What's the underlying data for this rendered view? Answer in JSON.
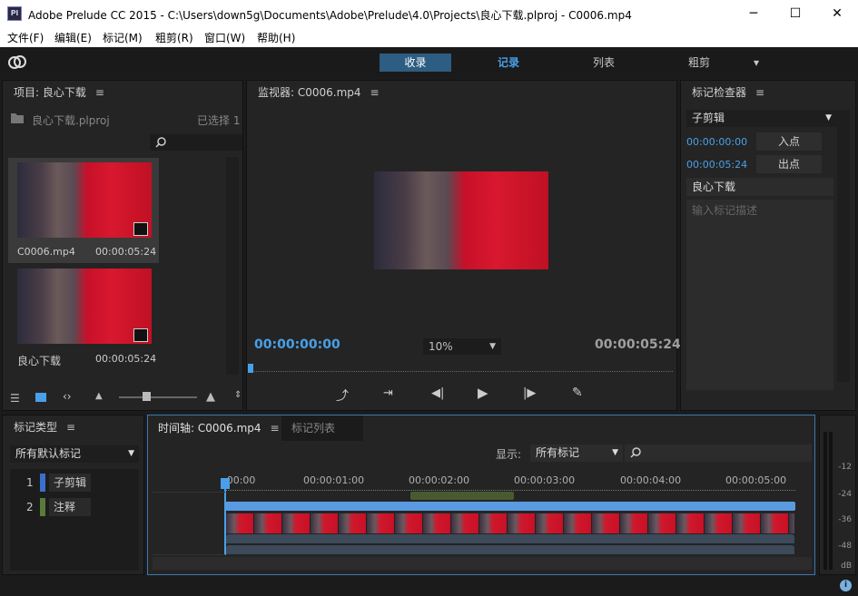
{
  "window": {
    "title": "Adobe Prelude CC 2015 - C:\\Users\\down5g\\Documents\\Adobe\\Prelude\\4.0\\Projects\\良心下载.plproj - C0006.mp4",
    "app_icon": "Pl",
    "minimize": "─",
    "maximize": "☐",
    "close": "✕"
  },
  "menu": [
    "文件(F)",
    "编辑(E)",
    "标记(M)",
    "粗剪(R)",
    "窗口(W)",
    "帮助(H)"
  ],
  "workspaces": {
    "ingest": "收录",
    "log": "记录",
    "list": "列表",
    "rough": "粗剪",
    "dropdown": "▾"
  },
  "project": {
    "title": "项目: 良心下载",
    "file": "良心下载.plproj",
    "selected": "已选择 1",
    "items": [
      {
        "name": "C0006.mp4",
        "duration": "00:00:05:24"
      },
      {
        "name": "良心下载",
        "duration": "00:00:05:24"
      }
    ]
  },
  "monitor": {
    "title": "监视器: C0006.mp4",
    "current_time": "00:00:00:00",
    "zoom": "10%",
    "end_time": "00:00:05:24"
  },
  "inspector": {
    "title": "标记检查器",
    "marker_type": "子剪辑",
    "in_time": "00:00:00:00",
    "in_label": "入点",
    "out_time": "00:00:05:24",
    "out_label": "出点",
    "name": "良心下载",
    "desc_placeholder": "输入标记描述"
  },
  "marker_types": {
    "title": "标记类型",
    "filter": "所有默认标记",
    "items": [
      {
        "num": "1",
        "label": "子剪辑",
        "color": "#3a6fd0"
      },
      {
        "num": "2",
        "label": "注释",
        "color": "#5a7a3a"
      }
    ]
  },
  "timeline": {
    "tab_active": "时间轴: C0006.mp4",
    "tab_other": "标记列表",
    "show_label": "显示:",
    "show_value": "所有标记",
    "ticks": [
      ";00:00",
      "00:00:01:00",
      "00:00:02:00",
      "00:00:03:00",
      "00:00:04:00",
      "00:00:05:00"
    ]
  },
  "meter": {
    "labels": [
      "-12",
      "-24",
      "-36",
      "-48",
      "dB"
    ]
  },
  "colors": {
    "accent": "#49a0e8",
    "active_ws": "#2d5d82",
    "panel": "#242424"
  }
}
